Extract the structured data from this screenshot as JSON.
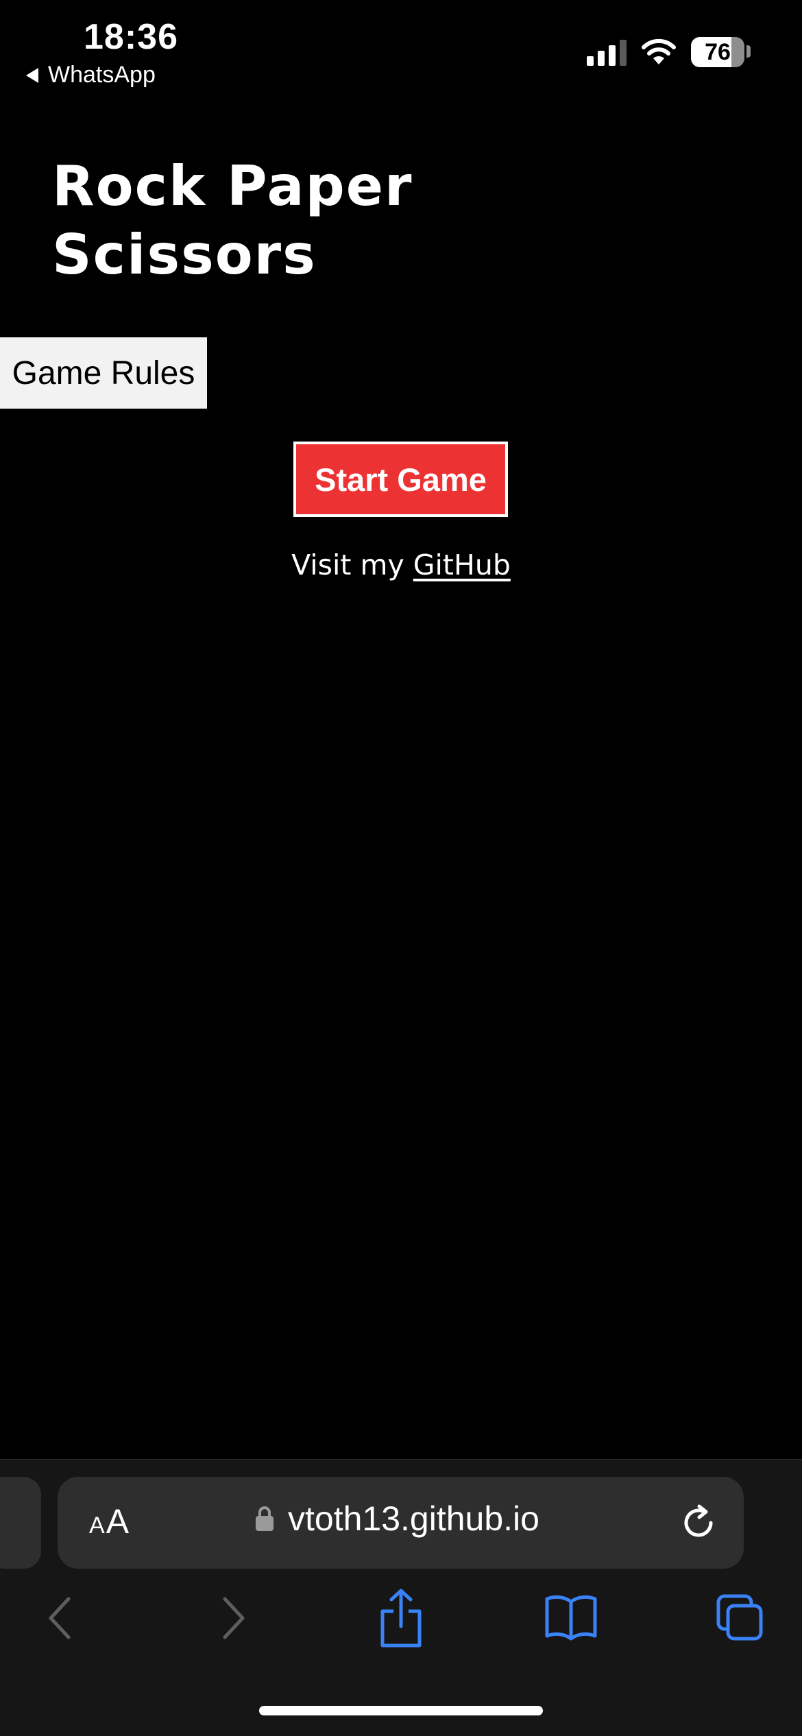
{
  "status_bar": {
    "time": "18:36",
    "back_app": "WhatsApp",
    "battery_percent": "76",
    "battery_level": 0.76,
    "icons": [
      "signal-icon",
      "wifi-icon",
      "battery-icon"
    ]
  },
  "page": {
    "title": "Rock Paper Scissors",
    "rules_button": "Game Rules",
    "start_button": "Start Game",
    "visit_prefix": "Visit my ",
    "github_link": "GitHub",
    "colors": {
      "background": "#000000",
      "start_button": "#ec3232",
      "rules_button": "#f2f2f2"
    }
  },
  "browser": {
    "text_size_label": "AA",
    "url": "vtoth13.github.io",
    "toolbar_icons": [
      "back-icon",
      "forward-icon",
      "share-icon",
      "bookmarks-icon",
      "tabs-icon"
    ],
    "accent": "#3a82f7"
  }
}
